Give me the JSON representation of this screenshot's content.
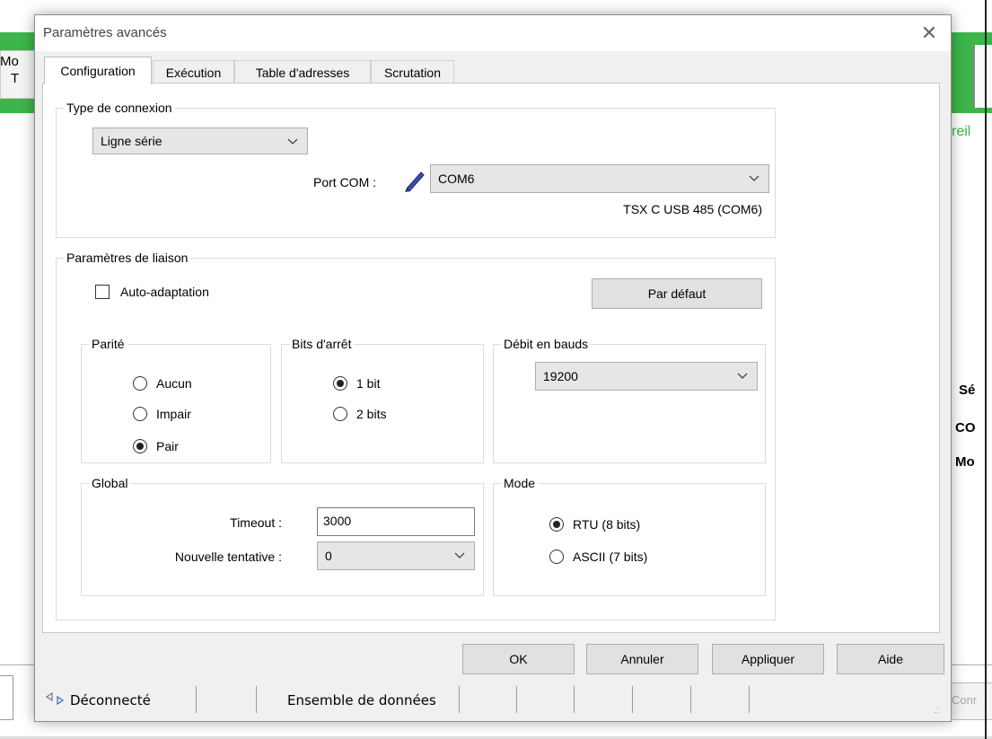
{
  "background": {
    "left_text_1": "Mo",
    "left_text_2": "T",
    "right_text_1": "reil",
    "right_text_2": "Sé",
    "right_text_3": "CO",
    "right_text_4": "Mo",
    "right_text_5": "Conr",
    "accent_color": "#3cb54a"
  },
  "dialog": {
    "title": "Paramètres avancés",
    "close_icon": "close-icon",
    "tabs": [
      {
        "label": "Configuration",
        "active": true
      },
      {
        "label": "Exécution",
        "active": false
      },
      {
        "label": "Table d'adresses",
        "active": false
      },
      {
        "label": "Scrutation",
        "active": false
      }
    ],
    "connection": {
      "group_label": "Type de connexion",
      "type_value": "Ligne série",
      "port_label": "Port COM :",
      "port_value": "COM6",
      "port_description": "TSX C USB 485 (COM6)",
      "edit_icon": "pencil-icon"
    },
    "link": {
      "group_label": "Paramètres de liaison",
      "auto_adapt_label": "Auto-adaptation",
      "auto_adapt_checked": false,
      "default_button": "Par défaut",
      "parity": {
        "label": "Parité",
        "options": [
          "Aucun",
          "Impair",
          "Pair"
        ],
        "selected": "Pair"
      },
      "stop_bits": {
        "label": "Bits d'arrêt",
        "options": [
          "1 bit",
          "2 bits"
        ],
        "selected": "1 bit"
      },
      "baud": {
        "label": "Débit en bauds",
        "value": "19200"
      },
      "global": {
        "label": "Global",
        "timeout_label": "Timeout :",
        "timeout_value": "3000",
        "retry_label": "Nouvelle tentative :",
        "retry_value": "0"
      },
      "mode": {
        "label": "Mode",
        "options": [
          "RTU (8 bits)",
          "ASCII (7 bits)"
        ],
        "selected": "RTU (8 bits)"
      }
    },
    "buttons": {
      "ok": "OK",
      "cancel": "Annuler",
      "apply": "Appliquer",
      "help": "Aide"
    }
  },
  "statusbar": {
    "connection_status": "Déconnecté",
    "dataset": "Ensemble de données"
  }
}
